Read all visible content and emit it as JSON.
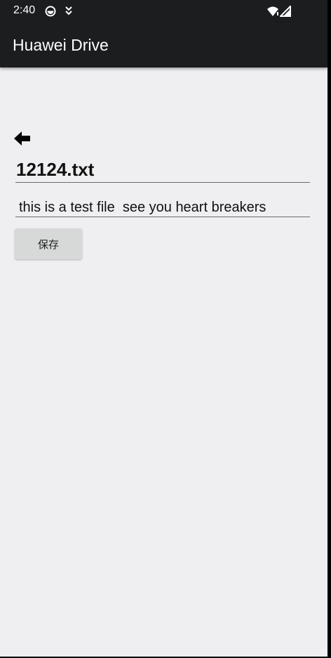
{
  "status_bar": {
    "time": "2:40",
    "icons": [
      "notification-icon",
      "download-icon",
      "wifi-icon",
      "signal-icon"
    ]
  },
  "app_bar": {
    "title": "Huawei Drive"
  },
  "editor": {
    "back_icon": "back-arrow-icon",
    "filename": "12124.txt",
    "content": "this is a test file  see you heart breakers",
    "save_label": "保存"
  },
  "colors": {
    "app_bar": "#1c1d1f",
    "background": "#efeff1",
    "button": "#d7d8d8"
  }
}
